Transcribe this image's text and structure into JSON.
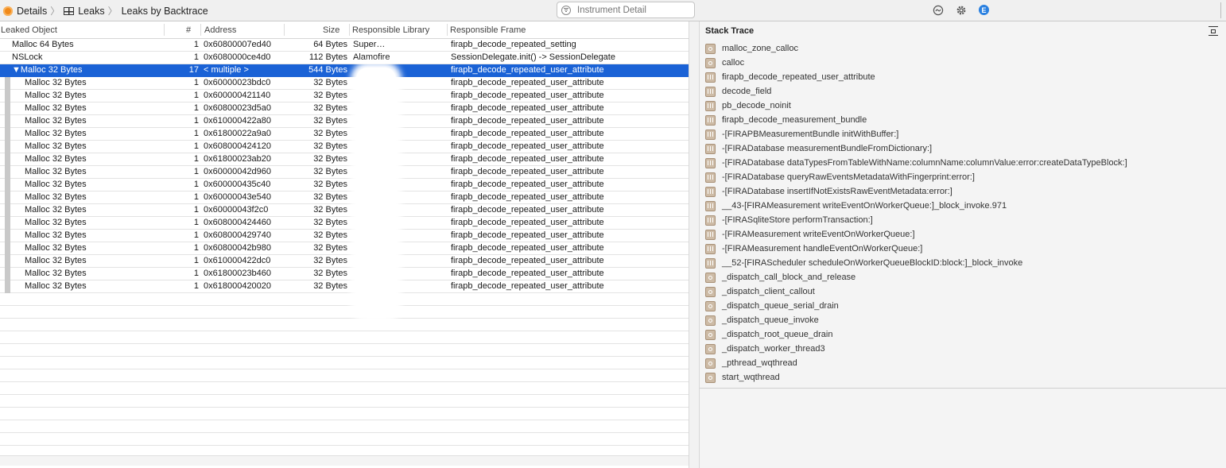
{
  "breadcrumb": {
    "items": [
      {
        "label": "Details",
        "icon": "instrument-icon"
      },
      {
        "label": "Leaks",
        "icon": "table-icon"
      },
      {
        "label": "Leaks by Backtrace",
        "icon": ""
      }
    ]
  },
  "search": {
    "placeholder": "Instrument Detail"
  },
  "toolbar_icons": [
    "call-tree-icon",
    "gear-icon",
    "extended-detail-icon"
  ],
  "extended_icon_letter": "E",
  "columns": {
    "leaked_object": "Leaked Object",
    "count": "#",
    "address": "Address",
    "size": "Size",
    "responsible_library": "Responsible Library",
    "responsible_frame": "Responsible Frame"
  },
  "rows": [
    {
      "obj": "Malloc 64 Bytes",
      "count": "1",
      "addr": "0x60800007ed40",
      "size": "64 Bytes",
      "lib": "Super…",
      "frame": "firapb_decode_repeated_setting",
      "level": 0
    },
    {
      "obj": "NSLock",
      "count": "1",
      "addr": "0x6080000ce4d0",
      "size": "112 Bytes",
      "lib": "Alamofire",
      "frame": "SessionDelegate.init() -> SessionDelegate",
      "level": 0
    },
    {
      "obj": "▼Malloc 32 Bytes",
      "count": "17",
      "addr": "< multiple >",
      "size": "544 Bytes",
      "lib": "",
      "frame": "firapb_decode_repeated_user_attribute",
      "level": 0,
      "selected": true
    },
    {
      "obj": "Malloc 32 Bytes",
      "count": "1",
      "addr": "0x60000023bdc0",
      "size": "32 Bytes",
      "lib": "",
      "frame": "firapb_decode_repeated_user_attribute",
      "level": 1
    },
    {
      "obj": "Malloc 32 Bytes",
      "count": "1",
      "addr": "0x600000421140",
      "size": "32 Bytes",
      "lib": "",
      "frame": "firapb_decode_repeated_user_attribute",
      "level": 1
    },
    {
      "obj": "Malloc 32 Bytes",
      "count": "1",
      "addr": "0x60800023d5a0",
      "size": "32 Bytes",
      "lib": "",
      "frame": "firapb_decode_repeated_user_attribute",
      "level": 1
    },
    {
      "obj": "Malloc 32 Bytes",
      "count": "1",
      "addr": "0x610000422a80",
      "size": "32 Bytes",
      "lib": "",
      "frame": "firapb_decode_repeated_user_attribute",
      "level": 1
    },
    {
      "obj": "Malloc 32 Bytes",
      "count": "1",
      "addr": "0x61800022a9a0",
      "size": "32 Bytes",
      "lib": "",
      "frame": "firapb_decode_repeated_user_attribute",
      "level": 1
    },
    {
      "obj": "Malloc 32 Bytes",
      "count": "1",
      "addr": "0x608000424120",
      "size": "32 Bytes",
      "lib": "",
      "frame": "firapb_decode_repeated_user_attribute",
      "level": 1
    },
    {
      "obj": "Malloc 32 Bytes",
      "count": "1",
      "addr": "0x61800023ab20",
      "size": "32 Bytes",
      "lib": "",
      "frame": "firapb_decode_repeated_user_attribute",
      "level": 1
    },
    {
      "obj": "Malloc 32 Bytes",
      "count": "1",
      "addr": "0x60000042d960",
      "size": "32 Bytes",
      "lib": "",
      "frame": "firapb_decode_repeated_user_attribute",
      "level": 1
    },
    {
      "obj": "Malloc 32 Bytes",
      "count": "1",
      "addr": "0x600000435c40",
      "size": "32 Bytes",
      "lib": "",
      "frame": "firapb_decode_repeated_user_attribute",
      "level": 1
    },
    {
      "obj": "Malloc 32 Bytes",
      "count": "1",
      "addr": "0x60000043e540",
      "size": "32 Bytes",
      "lib": "",
      "frame": "firapb_decode_repeated_user_attribute",
      "level": 1
    },
    {
      "obj": "Malloc 32 Bytes",
      "count": "1",
      "addr": "0x60000043f2c0",
      "size": "32 Bytes",
      "lib": "",
      "frame": "firapb_decode_repeated_user_attribute",
      "level": 1
    },
    {
      "obj": "Malloc 32 Bytes",
      "count": "1",
      "addr": "0x608000424460",
      "size": "32 Bytes",
      "lib": "",
      "frame": "firapb_decode_repeated_user_attribute",
      "level": 1
    },
    {
      "obj": "Malloc 32 Bytes",
      "count": "1",
      "addr": "0x608000429740",
      "size": "32 Bytes",
      "lib": "",
      "frame": "firapb_decode_repeated_user_attribute",
      "level": 1
    },
    {
      "obj": "Malloc 32 Bytes",
      "count": "1",
      "addr": "0x60800042b980",
      "size": "32 Bytes",
      "lib": "",
      "frame": "firapb_decode_repeated_user_attribute",
      "level": 1
    },
    {
      "obj": "Malloc 32 Bytes",
      "count": "1",
      "addr": "0x610000422dc0",
      "size": "32 Bytes",
      "lib": "",
      "frame": "firapb_decode_repeated_user_attribute",
      "level": 1
    },
    {
      "obj": "Malloc 32 Bytes",
      "count": "1",
      "addr": "0x61800023b460",
      "size": "32 Bytes",
      "lib": "",
      "frame": "firapb_decode_repeated_user_attribute",
      "level": 1
    },
    {
      "obj": "Malloc 32 Bytes",
      "count": "1",
      "addr": "0x618000420020",
      "size": "32 Bytes",
      "lib": "",
      "frame": "firapb_decode_repeated_user_attribute",
      "level": 1
    }
  ],
  "stack_trace": {
    "title": "Stack Trace",
    "frames": [
      {
        "label": "malloc_zone_calloc",
        "kind": "system"
      },
      {
        "label": "calloc",
        "kind": "system"
      },
      {
        "label": "firapb_decode_repeated_user_attribute",
        "kind": "user"
      },
      {
        "label": "decode_field",
        "kind": "user"
      },
      {
        "label": "pb_decode_noinit",
        "kind": "user"
      },
      {
        "label": "firapb_decode_measurement_bundle",
        "kind": "user"
      },
      {
        "label": "-[FIRAPBMeasurementBundle initWithBuffer:]",
        "kind": "user"
      },
      {
        "label": "-[FIRADatabase measurementBundleFromDictionary:]",
        "kind": "user"
      },
      {
        "label": "-[FIRADatabase dataTypesFromTableWithName:columnName:columnValue:error:createDataTypeBlock:]",
        "kind": "user"
      },
      {
        "label": "-[FIRADatabase queryRawEventsMetadataWithFingerprint:error:]",
        "kind": "user"
      },
      {
        "label": "-[FIRADatabase insertIfNotExistsRawEventMetadata:error:]",
        "kind": "user"
      },
      {
        "label": "__43-[FIRAMeasurement writeEventOnWorkerQueue:]_block_invoke.971",
        "kind": "user"
      },
      {
        "label": "-[FIRASqliteStore performTransaction:]",
        "kind": "user"
      },
      {
        "label": "-[FIRAMeasurement writeEventOnWorkerQueue:]",
        "kind": "user"
      },
      {
        "label": "-[FIRAMeasurement handleEventOnWorkerQueue:]",
        "kind": "user"
      },
      {
        "label": "__52-[FIRAScheduler scheduleOnWorkerQueueBlockID:block:]_block_invoke",
        "kind": "user"
      },
      {
        "label": "_dispatch_call_block_and_release",
        "kind": "system"
      },
      {
        "label": "_dispatch_client_callout",
        "kind": "system"
      },
      {
        "label": "_dispatch_queue_serial_drain",
        "kind": "system"
      },
      {
        "label": "_dispatch_queue_invoke",
        "kind": "system"
      },
      {
        "label": "_dispatch_root_queue_drain",
        "kind": "system"
      },
      {
        "label": "_dispatch_worker_thread3",
        "kind": "system"
      },
      {
        "label": "_pthread_wqthread",
        "kind": "system"
      },
      {
        "label": "start_wqthread",
        "kind": "system"
      }
    ]
  },
  "colors": {
    "selection": "#1a62d6",
    "instrument": "#f08a1c",
    "extended": "#2a80e0",
    "frame_icon": "#cdbba6"
  }
}
